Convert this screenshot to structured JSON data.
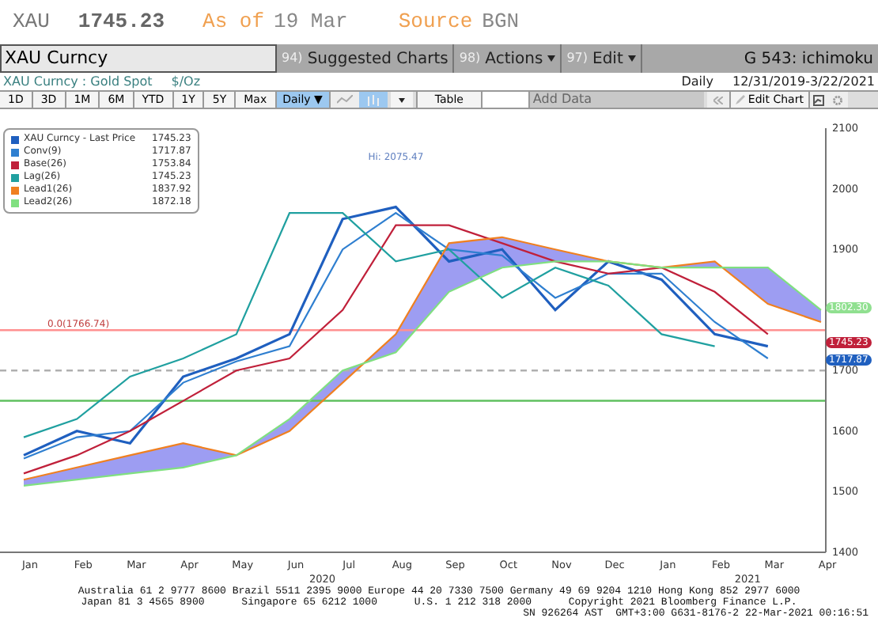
{
  "quote": {
    "ticker": "XAU",
    "price": "1745.23",
    "as_of_label": "As of",
    "as_of": "19 Mar",
    "source_label": "Source",
    "source": "BGN"
  },
  "toolbar": {
    "security": "XAU Curncy",
    "menus": [
      {
        "code": "94)",
        "label": "Suggested Charts",
        "caret": false
      },
      {
        "code": "98)",
        "label": "Actions",
        "caret": true
      },
      {
        "code": "97)",
        "label": "Edit",
        "caret": true
      }
    ],
    "chart_name": "G 543: ichimoku"
  },
  "subtitle": {
    "security": "XAU Curncy : Gold Spot",
    "unit": "$/Oz",
    "period": "Daily",
    "range": "12/31/2019-3/22/2021"
  },
  "controls": {
    "ranges": [
      "1D",
      "3D",
      "1M",
      "6M",
      "YTD",
      "1Y",
      "5Y",
      "Max"
    ],
    "frequency": "Daily ▼",
    "line_selected": false,
    "bar_selected": true,
    "table": "Table",
    "add_data": "Add Data",
    "edit_chart": "Edit Chart"
  },
  "chart": {
    "chart_data": {
      "type": "line",
      "categories": [
        "Jan",
        "Feb",
        "Mar",
        "Apr",
        "May",
        "Jun",
        "Jul",
        "Aug",
        "Sep",
        "Oct",
        "Nov",
        "Dec",
        "Jan",
        "Feb",
        "Mar",
        "Apr"
      ],
      "ylim": [
        1400,
        2100
      ],
      "yticks": [
        1400,
        1500,
        1600,
        1700,
        1900,
        2000,
        2100
      ],
      "legend": true,
      "series": [
        {
          "name": "XAU Curncy - Last Price",
          "color": "#1f5fbf",
          "values": [
            1560,
            1600,
            1580,
            1690,
            1720,
            1760,
            1950,
            1970,
            1880,
            1900,
            1800,
            1880,
            1850,
            1760,
            1740,
            null
          ]
        },
        {
          "name": "Conv(9)",
          "color": "#2f7fd0",
          "values": [
            1555,
            1590,
            1600,
            1680,
            1715,
            1740,
            1900,
            1960,
            1900,
            1890,
            1820,
            1860,
            1860,
            1780,
            1720,
            null
          ]
        },
        {
          "name": "Base(26)",
          "color": "#c0203a",
          "values": [
            1530,
            1560,
            1600,
            1650,
            1700,
            1720,
            1800,
            1940,
            1940,
            1910,
            1880,
            1860,
            1870,
            1830,
            1760,
            null
          ]
        },
        {
          "name": "Lag(26)",
          "color": "#20a0a0",
          "values": [
            1590,
            1620,
            1690,
            1720,
            1760,
            1960,
            1960,
            1880,
            1900,
            1820,
            1870,
            1840,
            1760,
            1740,
            null,
            null
          ]
        },
        {
          "name": "Lead1(26)",
          "color": "#f08020",
          "values": [
            1520,
            1540,
            1560,
            1580,
            1560,
            1600,
            1680,
            1760,
            1910,
            1920,
            1900,
            1880,
            1870,
            1880,
            1810,
            1780
          ]
        },
        {
          "name": "Lead2(26)",
          "color": "#80e080",
          "values": [
            1510,
            1520,
            1530,
            1540,
            1560,
            1620,
            1700,
            1730,
            1830,
            1870,
            1880,
            1880,
            1870,
            1870,
            1870,
            1800
          ]
        }
      ],
      "ref_lines": [
        {
          "axis": "y",
          "value": 1766.74,
          "color": "#ff9090",
          "label": "0.0(1766.74)"
        },
        {
          "axis": "y",
          "value": 1700,
          "color": "#b0b0b0"
        },
        {
          "axis": "y",
          "value": 1650,
          "color": "#60c060"
        }
      ],
      "annotations": [
        "Hi: 2075.47"
      ]
    },
    "legend_values": [
      "1745.23",
      "1717.87",
      "1753.84",
      "1745.23",
      "1837.92",
      "1872.18"
    ],
    "year_labels": [
      "2020",
      "2021"
    ],
    "price_tags": [
      {
        "value": "1802.30",
        "color": "#90e090"
      },
      {
        "value": "1745.23",
        "color": "#c0203a"
      },
      {
        "value": "1717.87",
        "color": "#1f5fbf"
      }
    ]
  },
  "footer": [
    "Australia 61 2 9777 8600 Brazil 5511 2395 9000 Europe 44 20 7330 7500 Germany 49 69 9204 1210 Hong Kong 852 2977 6000",
    "Japan 81 3 4565 8900      Singapore 65 6212 1000      U.S. 1 212 318 2000      Copyright 2021 Bloomberg Finance L.P.",
    "SN 926264 AST  GMT+3:00 G631-8176-2 22-Mar-2021 00:16:51"
  ]
}
